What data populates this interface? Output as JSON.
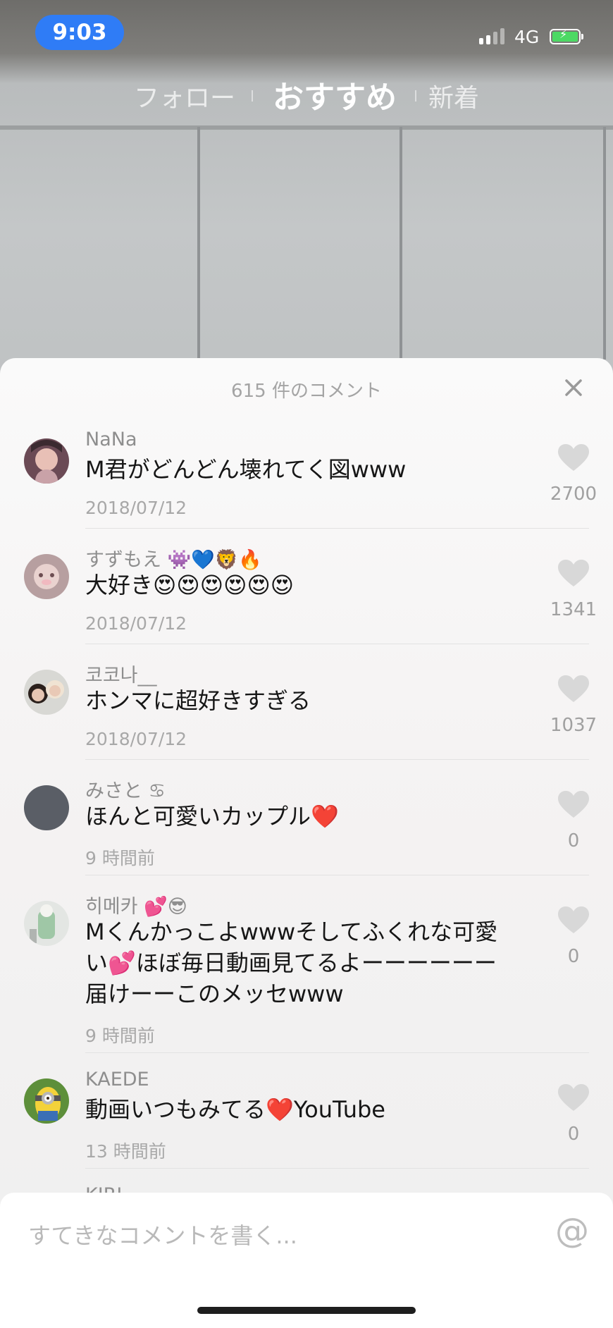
{
  "status_bar": {
    "time": "9:03",
    "network": "4G"
  },
  "nav_tabs": [
    {
      "label": "フォロー",
      "active": false
    },
    {
      "label": "おすすめ",
      "active": true
    },
    {
      "label": "新着",
      "active": false
    }
  ],
  "comments_sheet": {
    "title": "615 件のコメント",
    "comments": [
      {
        "username": "NaNa",
        "text": "M君がどんどん壊れてく図www",
        "date": "2018/07/12",
        "likes": "2700"
      },
      {
        "username": "すずもえ 👾💙🦁🔥",
        "text": "大好き😍😍😍😍😍😍",
        "date": "2018/07/12",
        "likes": "1341"
      },
      {
        "username": "코코나__",
        "text": "ホンマに超好きすぎる",
        "date": "2018/07/12",
        "likes": "1037"
      },
      {
        "username": "みさと ♋",
        "text": "ほんと可愛いカップル❤️",
        "date": "9 時間前",
        "likes": "0"
      },
      {
        "username": "히메카 💕😎",
        "text_lines": [
          "Mくんかっこよwwwそしてふくれな可愛",
          "い💕ほぼ毎日動画見てるよーーーーーー",
          "届けーーこのメッセwww"
        ],
        "date": "9 時間前",
        "likes": "0"
      },
      {
        "username": "KAEDE",
        "text": "動画いつもみてる❤️YouTube",
        "date": "13 時間前",
        "likes": "0"
      },
      {
        "username": "KIRI"
      }
    ]
  },
  "input": {
    "placeholder": "すてきなコメントを書く...",
    "mention_symbol": "@"
  },
  "colors": {
    "time_pill": "#2f7cf6",
    "battery": "#4cd964",
    "heart": "#d8d8d8"
  }
}
